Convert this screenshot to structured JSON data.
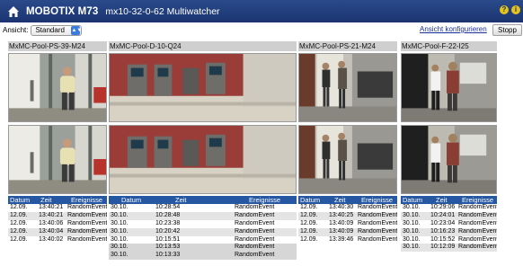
{
  "header": {
    "brand": "MOBOTIX M73",
    "subtitle": "mx10-32-0-62 Multiwatcher",
    "help_icon_glyph": "?",
    "info_icon_glyph": "i"
  },
  "toolbar": {
    "ansicht_label": "Ansicht:",
    "view_select_value": "Standard",
    "configure_link": "Ansicht konfigurieren",
    "stop_button": "Stopp"
  },
  "event_columns": {
    "date": "Datum",
    "time": "Zeit",
    "events": "Ereignisse"
  },
  "cameras": [
    {
      "name": "MxMC-Pool-PS-39-M24",
      "events": [
        [
          "12.09.",
          "13:40:21",
          "RandomEvent"
        ],
        [
          "12.09.",
          "13:40:21",
          "RandomEvent"
        ],
        [
          "12.09.",
          "13:40:06",
          "RandomEvent"
        ],
        [
          "12.09.",
          "13:40:04",
          "RandomEvent"
        ],
        [
          "12.09.",
          "13:40:02",
          "RandomEvent"
        ]
      ]
    },
    {
      "name": "MxMC-Pool-D-10-Q24",
      "events": [
        [
          "30.10.",
          "10:28:54",
          "RandomEvent"
        ],
        [
          "30.10.",
          "10:28:48",
          "RandomEvent"
        ],
        [
          "30.10.",
          "10:23:38",
          "RandomEvent"
        ],
        [
          "30.10.",
          "10:20:42",
          "RandomEvent"
        ],
        [
          "30.10.",
          "10:15:51",
          "RandomEvent"
        ],
        [
          "30.10.",
          "10:13:53",
          "RandomEvent"
        ],
        [
          "30.10.",
          "10:13:33",
          "RandomEvent"
        ]
      ]
    },
    {
      "name": "MxMC-Pool-PS-21-M24",
      "events": [
        [
          "12.09.",
          "13:40:30",
          "RandomEvent"
        ],
        [
          "12.09.",
          "13:40:25",
          "RandomEvent"
        ],
        [
          "12.09.",
          "13:40:09",
          "RandomEvent"
        ],
        [
          "12.09.",
          "13:40:09",
          "RandomEvent"
        ],
        [
          "12.09.",
          "13:39:46",
          "RandomEvent"
        ]
      ]
    },
    {
      "name": "MxMC-Pool-F-22-I25",
      "events": [
        [
          "30.10.",
          "10:29:06",
          "RandomEvent"
        ],
        [
          "30.10.",
          "10:24:01",
          "RandomEvent"
        ],
        [
          "30.10.",
          "10:23:04",
          "RandomEvent"
        ],
        [
          "30.10.",
          "10:16:23",
          "RandomEvent"
        ],
        [
          "30.10.",
          "10:15:52",
          "RandomEvent"
        ],
        [
          "30.10.",
          "10:12:09",
          "RandomEvent"
        ]
      ]
    }
  ],
  "colors": {
    "titlebar": "#1b3470",
    "event_header": "#2557a3",
    "link": "#1a2f9e"
  }
}
